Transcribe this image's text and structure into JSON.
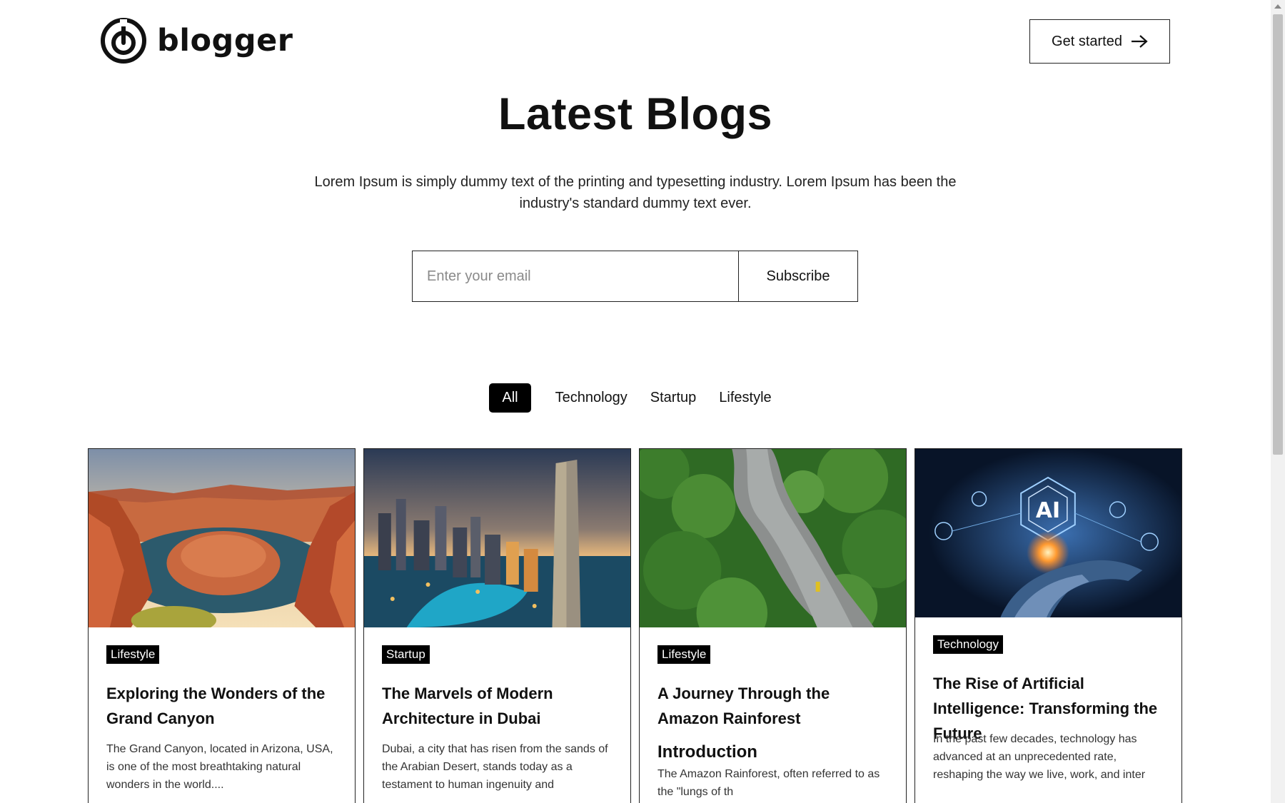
{
  "header": {
    "logo_text": "blogger",
    "cta_label": "Get started"
  },
  "hero": {
    "title": "Latest Blogs",
    "description": "Lorem Ipsum is simply dummy text of the printing and typesetting industry. Lorem Ipsum has been the industry's standard dummy text ever."
  },
  "subscribe": {
    "email_placeholder": "Enter your email",
    "email_value": "",
    "button_label": "Subscribe"
  },
  "filters": {
    "items": [
      "All",
      "Technology",
      "Startup",
      "Lifestyle"
    ],
    "active": "All"
  },
  "cards": [
    {
      "category": "Lifestyle",
      "title": "Exploring the Wonders of the Grand Canyon",
      "excerpt": "The Grand Canyon, located in Arizona, USA, is one of the most breathtaking natural wonders in the world...."
    },
    {
      "category": "Startup",
      "title": "The Marvels of Modern Architecture in Dubai",
      "excerpt": "Dubai, a city that has risen from the sands of the Arabian Desert, stands today as a testament to human ingenuity and"
    },
    {
      "category": "Lifestyle",
      "title": "A Journey Through the Amazon Rainforest",
      "sub_heading": "Introduction",
      "excerpt": "The Amazon Rainforest, often referred to as the \"lungs of th"
    },
    {
      "category": "Technology",
      "title": "The Rise of Artificial Intelligence: Transforming the Future",
      "excerpt": "In the past few decades, technology has advanced at an unprecedented rate, reshaping the way we live, work, and inter",
      "image_text": "AI"
    }
  ],
  "colors": {
    "text": "#111111",
    "active_filter_bg": "#000000",
    "badge_bg": "#000000",
    "border": "#222222"
  }
}
